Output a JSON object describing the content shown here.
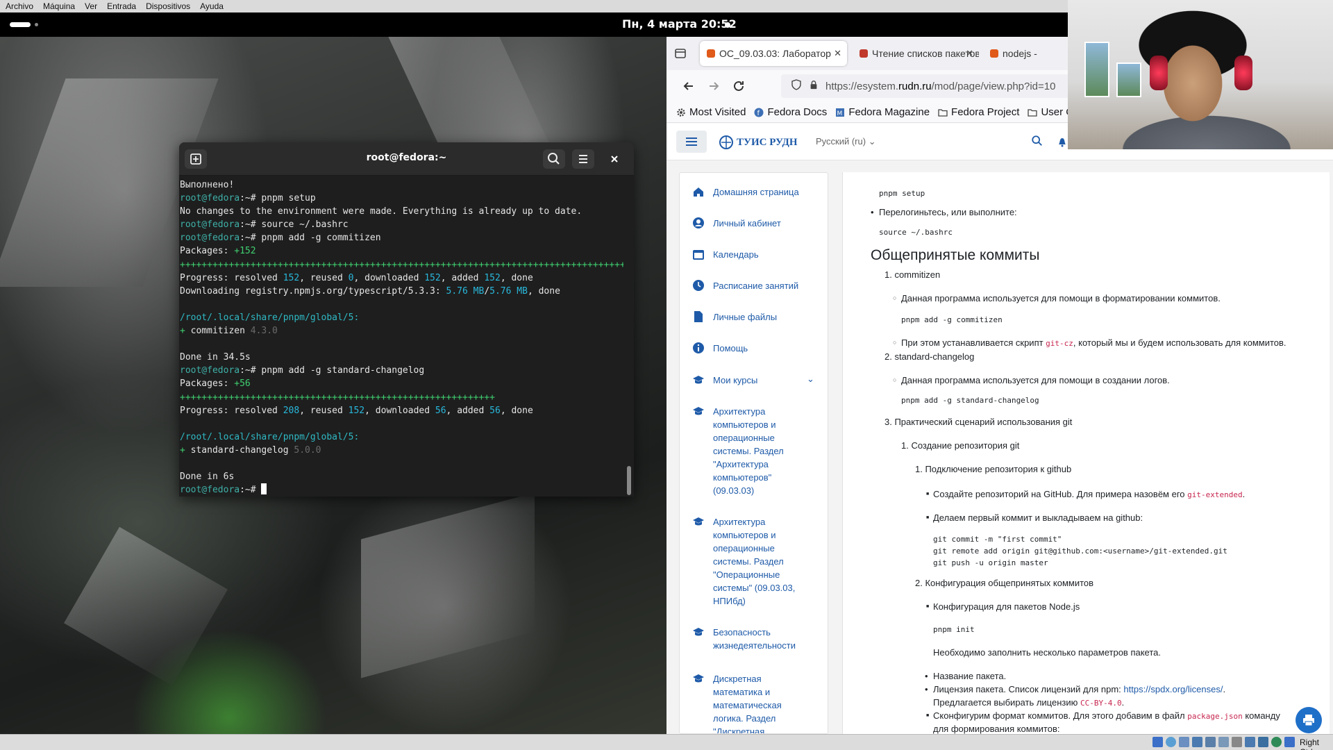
{
  "vm_menu": [
    "Archivo",
    "Máquina",
    "Ver",
    "Entrada",
    "Dispositivos",
    "Ayuda"
  ],
  "topbar": {
    "clock": "Пн, 4 марта  20:52"
  },
  "terminal": {
    "title": "root@fedora:~",
    "lines": [
      [
        [
          "Выполнено!",
          ""
        ]
      ],
      [
        [
          "root@fedora",
          "c-prompt"
        ],
        [
          ":~# pnpm setup",
          ""
        ]
      ],
      [
        [
          "No changes to the environment were made. Everything is already up to date.",
          ""
        ]
      ],
      [
        [
          "root@fedora",
          "c-prompt"
        ],
        [
          ":~# source ~/.bashrc",
          ""
        ]
      ],
      [
        [
          "root@fedora",
          "c-prompt"
        ],
        [
          ":~# pnpm add -g commitizen",
          ""
        ]
      ],
      [
        [
          "Packages: ",
          ""
        ],
        [
          "+152",
          "c-green"
        ]
      ],
      [
        [
          "++++++++++++++++++++++++++++++++++++++++++++++++++++++++++++++++++++++++++++++++++",
          "c-green"
        ]
      ],
      [
        [
          "Progress: resolved ",
          ""
        ],
        [
          "152",
          "c-num"
        ],
        [
          ", reused ",
          ""
        ],
        [
          "0",
          "c-num"
        ],
        [
          ", downloaded ",
          ""
        ],
        [
          "152",
          "c-num"
        ],
        [
          ", added ",
          ""
        ],
        [
          "152",
          "c-num"
        ],
        [
          ", done",
          ""
        ]
      ],
      [
        [
          "Downloading registry.npmjs.org/typescript/5.3.3: ",
          ""
        ],
        [
          "5.76 MB",
          "c-num"
        ],
        [
          "/",
          ""
        ],
        [
          "5.76 MB",
          "c-num"
        ],
        [
          ", done",
          ""
        ]
      ],
      [
        [
          "",
          ""
        ]
      ],
      [
        [
          "/root/.local/share/pnpm/global/5:",
          "c-path"
        ]
      ],
      [
        [
          "+ ",
          "c-green"
        ],
        [
          "commitizen ",
          ""
        ],
        [
          "4.3.0",
          "c-dim"
        ]
      ],
      [
        [
          "",
          ""
        ]
      ],
      [
        [
          "Done in 34.5s",
          ""
        ]
      ],
      [
        [
          "root@fedora",
          "c-prompt"
        ],
        [
          ":~# pnpm add -g standard-changelog",
          ""
        ]
      ],
      [
        [
          "Packages: ",
          ""
        ],
        [
          "+56",
          "c-green"
        ]
      ],
      [
        [
          "++++++++++++++++++++++++++++++++++++++++++++++++++++++++++",
          "c-green"
        ]
      ],
      [
        [
          "Progress: resolved ",
          ""
        ],
        [
          "208",
          "c-num"
        ],
        [
          ", reused ",
          ""
        ],
        [
          "152",
          "c-num"
        ],
        [
          ", downloaded ",
          ""
        ],
        [
          "56",
          "c-num"
        ],
        [
          ", added ",
          ""
        ],
        [
          "56",
          "c-num"
        ],
        [
          ", done",
          ""
        ]
      ],
      [
        [
          "",
          ""
        ]
      ],
      [
        [
          "/root/.local/share/pnpm/global/5:",
          "c-path"
        ]
      ],
      [
        [
          "+ ",
          "c-green"
        ],
        [
          "standard-changelog ",
          ""
        ],
        [
          "5.0.0",
          "c-dim"
        ]
      ],
      [
        [
          "",
          ""
        ]
      ],
      [
        [
          "Done in 6s",
          ""
        ]
      ],
      [
        [
          "root@fedora",
          "c-prompt"
        ],
        [
          ":~# ",
          ""
        ]
      ]
    ]
  },
  "browser": {
    "tabs": [
      {
        "title": "ОС_09.03.03: Лаборатор",
        "favicon_color": "#e05a1a",
        "active": true
      },
      {
        "title": "Чтение списков пакетов",
        "favicon_color": "#c0392b",
        "active": false
      },
      {
        "title": "nodejs - ",
        "favicon_color": "#e05a1a",
        "active": false
      }
    ],
    "url_prefix": "https://esystem.",
    "url_domain": "rudn.ru",
    "url_path": "/mod/page/view.php?id=10",
    "bookmarks": [
      {
        "label": "Most Visited",
        "icon": "gear-icon",
        "color": "#444"
      },
      {
        "label": "Fedora Docs",
        "icon": "fedora-icon",
        "color": "#3c6eb4"
      },
      {
        "label": "Fedora Magazine",
        "icon": "magazine-icon",
        "color": "#3c6eb4"
      },
      {
        "label": "Fedora Project",
        "icon": "folder-icon",
        "color": "#444"
      },
      {
        "label": "User Co",
        "icon": "folder-icon",
        "color": "#444"
      }
    ]
  },
  "moodle": {
    "site_name": "ТУИС РУДН",
    "language": "Русский (ru)",
    "drawer": [
      {
        "label": "Домашняя страница",
        "icon": "home-icon"
      },
      {
        "label": "Личный кабинет",
        "icon": "user-icon"
      },
      {
        "label": "Календарь",
        "icon": "calendar-icon"
      },
      {
        "label": "Расписание занятий",
        "icon": "clock-icon"
      },
      {
        "label": "Личные файлы",
        "icon": "file-icon"
      },
      {
        "label": "Помощь",
        "icon": "info-icon"
      },
      {
        "label": "Мои курсы",
        "icon": "mortarboard-icon"
      }
    ],
    "courses": [
      "Архитектура компьютеров и операционные системы. Раздел \"Архитектура компьютеров\" (09.03.03)",
      "Архитектура компьютеров и операционные системы. Раздел \"Операционные системы\" (09.03.03, НПИбд)",
      "Безопасность жизнедеятельности",
      "Дискретная математика и математическая логика. Раздел \"Дискретная"
    ],
    "content": {
      "code_pnpm_setup": "pnpm setup",
      "relogin": "Перелогиньтесь, или выполните:",
      "code_source": "source ~/.bashrc",
      "heading": "Общепринятые коммиты",
      "item1": "1. commitizen",
      "item1_desc": "Данная программа используется для помощи в форматировании коммитов.",
      "code_commitizen": "pnpm add -g commitizen",
      "item1_note_a": "При этом устанавливается скрипт ",
      "item1_note_code": "git-cz",
      "item1_note_b": ", который мы и будем использовать для коммитов.",
      "item2": "2. standard-changelog",
      "item2_desc": "Данная программа используется для помощи в создании логов.",
      "code_changelog": "pnpm add -g standard-changelog",
      "item3": "3. Практический сценарий использования git",
      "sub1": "1. Создание репозитория git",
      "sub1_1": "1. Подключение репозитория к github",
      "repo_a": "Создайте репозиторий на GitHub. Для примера назовём его ",
      "repo_code": "git-extended",
      "repo_b": ".",
      "first_commit": "Делаем первый коммит и выкладываем на github:",
      "code_git1": "git commit -m \"first commit\"",
      "code_git2": "git remote add origin git@github.com:<username>/git-extended.git",
      "code_git3": "git push -u origin master",
      "sub1_2": "2. Конфигурация общепринятых коммитов",
      "nodejs_cfg": "Конфигурация для пакетов Node.js",
      "code_init": "pnpm init",
      "fill_params": "Необходимо заполнить несколько параметров пакета.",
      "pkg_name": "Название пакета.",
      "license_a": "Лицензия пакета. Список лицензий для npm: ",
      "license_link": "https://spdx.org/licenses/",
      "license_b": ".",
      "license_suggest_a": "Предлагается выбирать лицензию ",
      "license_code": "CC-BY-4.0",
      "license_suggest_b": ".",
      "config_a": "Сконфигурим формат коммитов. Для этого добавим в файл ",
      "config_code": "package.json",
      "config_b": " команду",
      "config_cut": "для формирования коммитов:"
    }
  },
  "statusbar": {
    "host_key": "Right Ctrl"
  }
}
